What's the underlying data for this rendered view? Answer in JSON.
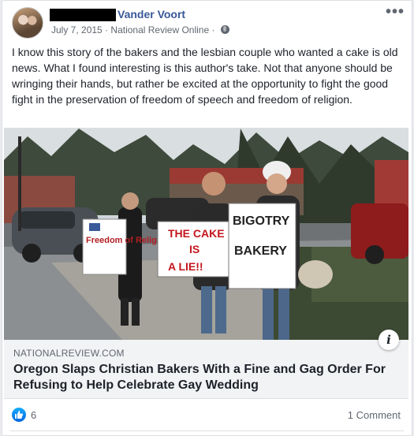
{
  "post": {
    "author_name": "Vander Voort",
    "date": "July 7, 2015",
    "separator": "·",
    "source": "National Review Online",
    "separator2": "·",
    "audience_icon": "globe-icon",
    "more_label": "•••",
    "text": "I know this story of the bakers and the lesbian couple who wanted a cake is old news. What I found interesting is this author's take. Not that anyone should be wringing their hands, but rather be excited at the opportunity to fight the good fight in the preservation of freedom of speech and freedom of religion."
  },
  "link": {
    "domain": "NATIONALREVIEW.COM",
    "title": "Oregon Slaps Christian Bakers With a Fine and Gag Order For Refusing to Help Celebrate Gay Wedding",
    "info_label": "i",
    "photo": {
      "sign_1": "Freedom of Religion",
      "sign_2_line1": "THE CAKE",
      "sign_2_line2": "IS",
      "sign_2_line3": "A LIE!!",
      "sign_3_line1": "BIGOTRY",
      "sign_3_line2": "BAKERY"
    }
  },
  "footer": {
    "like_count": "6",
    "comment_count": "1 Comment"
  },
  "colors": {
    "link_blue": "#385898",
    "meta_gray": "#606770",
    "like_blue": "#0165e1",
    "card_bg": "#f2f3f5"
  }
}
